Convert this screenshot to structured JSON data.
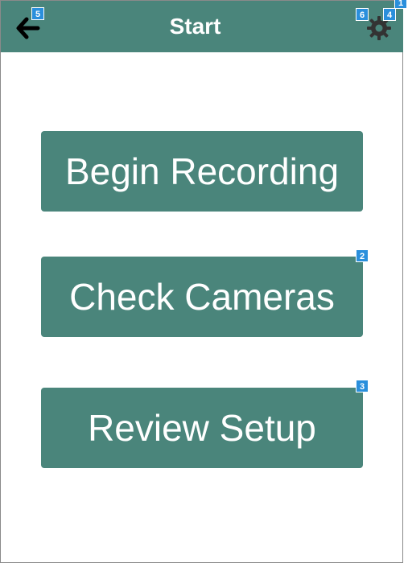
{
  "header": {
    "title": "Start",
    "back_icon": "arrow-left-icon",
    "settings_icon": "gear-icon"
  },
  "buttons": [
    {
      "label": "Begin Recording"
    },
    {
      "label": "Check Cameras"
    },
    {
      "label": "Review Setup"
    }
  ],
  "badges": [
    "1",
    "2",
    "3",
    "4",
    "5",
    "6"
  ],
  "colors": {
    "primary": "#4a857b",
    "text": "#ffffff",
    "icon": "#000000",
    "badge": "#2a8fdc"
  }
}
